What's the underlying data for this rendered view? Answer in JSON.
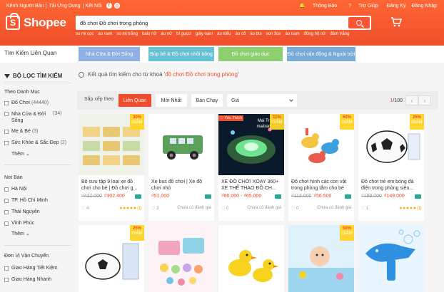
{
  "header": {
    "topnav": [
      "Kênh Người Bán",
      "Tải Ứng Dụng",
      "Kết Nối"
    ],
    "social": [
      "f",
      "◎"
    ],
    "topright": [
      "Thông Báo",
      "Trợ Giúp",
      "Đăng Ký",
      "Đăng Nhập"
    ],
    "logo_text": "Shopee",
    "logo_letter": "S",
    "search_value": "đồ chơi Đồ chơi trong phòng",
    "hotkeys": [
      "so mi cọc",
      "áo nam",
      "so mi trắng",
      "balo nữ",
      "áo nữ",
      "bí gucci",
      "giày nam",
      "áo kiểu",
      "áo cổ",
      "áo bts",
      "son 3ce",
      "áo nam",
      "đồng hồ nữ",
      "đầm trắng"
    ],
    "colors": {
      "brand": "#ee4d2d"
    }
  },
  "related": {
    "label": "Tìm Kiếm Liên Quan",
    "items": [
      "Nhà Cửa & Đời Sống",
      "Búp bê & Đồ chơi nhồi bông",
      "Đồ chơi giáo dục",
      "Đồ chơi vận động & Ngoài trời"
    ]
  },
  "sidebar": {
    "heading": "BỘ LỌC TÌM KIẾM",
    "category_title": "Theo Danh Mục",
    "categories": [
      {
        "label": "Đồ Chơi",
        "count": "(44440)"
      },
      {
        "label": "Nhà Cửa & Đời",
        "label2": "Sống",
        "count": "(34)"
      },
      {
        "label": "Mẹ & Bé",
        "count": "(3)"
      },
      {
        "label": "Sức Khỏe & Sắc Đẹp",
        "count": "(2)"
      }
    ],
    "more_label": "Thêm",
    "location_title": "Nơi Bán",
    "locations": [
      "Hà Nội",
      "TP. Hồ Chí Minh",
      "Thái Nguyên",
      "Vĩnh Phúc"
    ],
    "more_label2": "Thêm",
    "shipping_title": "Đơn Vị Vận Chuyển",
    "shipping": [
      "Giao Hàng Tiết Kiệm",
      "Giao Hàng Nhanh"
    ]
  },
  "notice": {
    "prefix": "Kết quả tìm kiếm cho từ khoá '",
    "keyword": "đồ chơi Đồ chơi trong phòng",
    "suffix": "'"
  },
  "sortbar": {
    "label": "Sắp xếp theo",
    "options": [
      "Liên Quan",
      "Mới Nhất",
      "Bán Chạy"
    ],
    "price_label": "Giá",
    "page_current": "1",
    "page_total": "/100",
    "prev": "‹",
    "next": "›"
  },
  "products": [
    {
      "name": "Bộ sưu tập 9 loại xe đồ chơi cho bé | Đồ chơi g...",
      "old_price": "₫432.000",
      "price": "₫302.400",
      "likes": "♡ 4",
      "rating": "★★★★★ (1)",
      "discount": "30%",
      "badge_word": "GIẢM"
    },
    {
      "name": "Xe bus đồ chơi | Xe đồ chơi nhỏ",
      "old_price": "",
      "price": "₫51.000",
      "likes": "♡ 3",
      "rating_text": "Chưa có đánh giá"
    },
    {
      "name": "XE ĐỒ CHƠI XOAY 360+ XE THỂ THAO ĐỒ CH...",
      "old_price": "",
      "price": "₫80.000 - ₫65.000",
      "likes": "♡ 0",
      "rating_text": "Chưa có đánh giá",
      "discount": "11%",
      "badge_word": "GIẢM",
      "favorite": "♡ Yêu Thích",
      "overlay": "Mai Tr Shop maitram8912"
    },
    {
      "name": "Đồ chơi hình các con vật trong phòng tắm cho bé",
      "old_price": "₫113.000",
      "price": "₫56.500",
      "likes": "♡ 0",
      "rating_text": "Chưa có đánh giá",
      "discount": "50%",
      "badge_word": "GIẢM"
    },
    {
      "name": "Đồ chơi trẻ em bóng đá điện trong phòng siêu...",
      "old_price": "₫199.000",
      "price": "₫149.000",
      "likes": "♡ 1",
      "rating": "★★★★★ (1)",
      "discount": "25%",
      "badge_word": "GIẢM"
    },
    {
      "discount": "25%",
      "badge_word": "GIẢM"
    },
    {
      "discount": "",
      "badge_word": ""
    },
    {
      "discount": "",
      "badge_word": ""
    },
    {
      "discount": "50%",
      "badge_word": "GIẢM"
    },
    {
      "discount": "",
      "badge_word": ""
    }
  ]
}
